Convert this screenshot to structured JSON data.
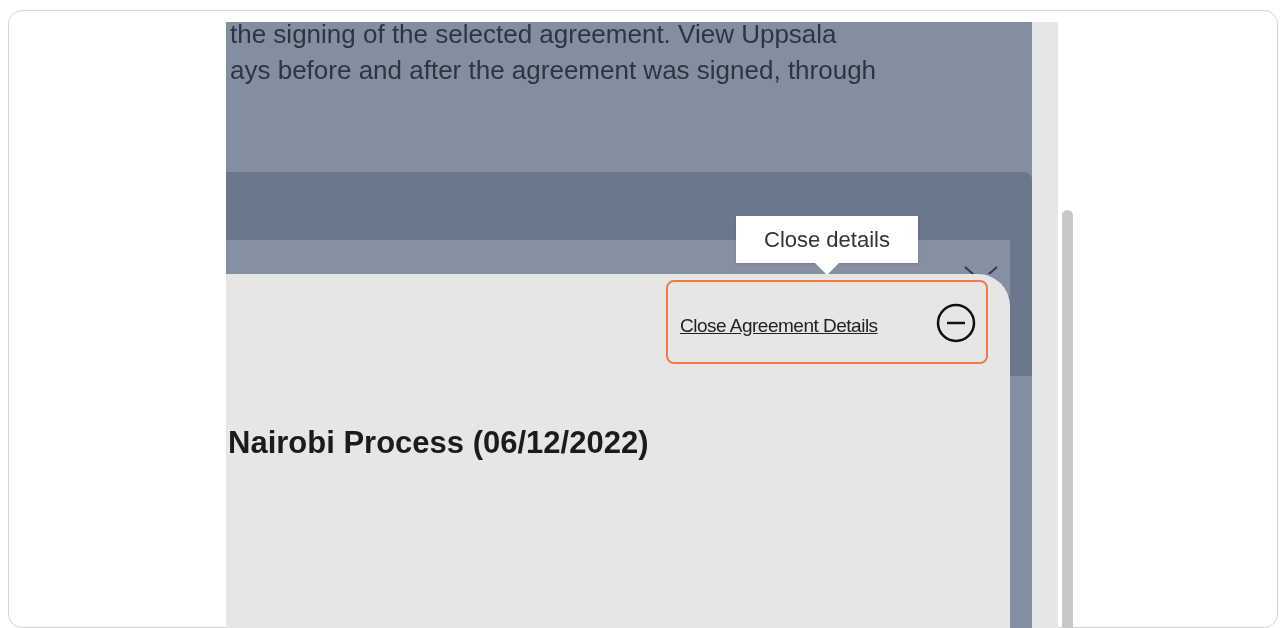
{
  "intro_text": [
    "the signing of the selected agreement. View Uppsala",
    "ays before and after the agreement was signed, through"
  ],
  "tooltip": {
    "text": "Close details"
  },
  "details_card": {
    "close_link": "Close Agreement Details",
    "highlighted": true,
    "title": "Nairobi Process (06/12/2022)"
  }
}
